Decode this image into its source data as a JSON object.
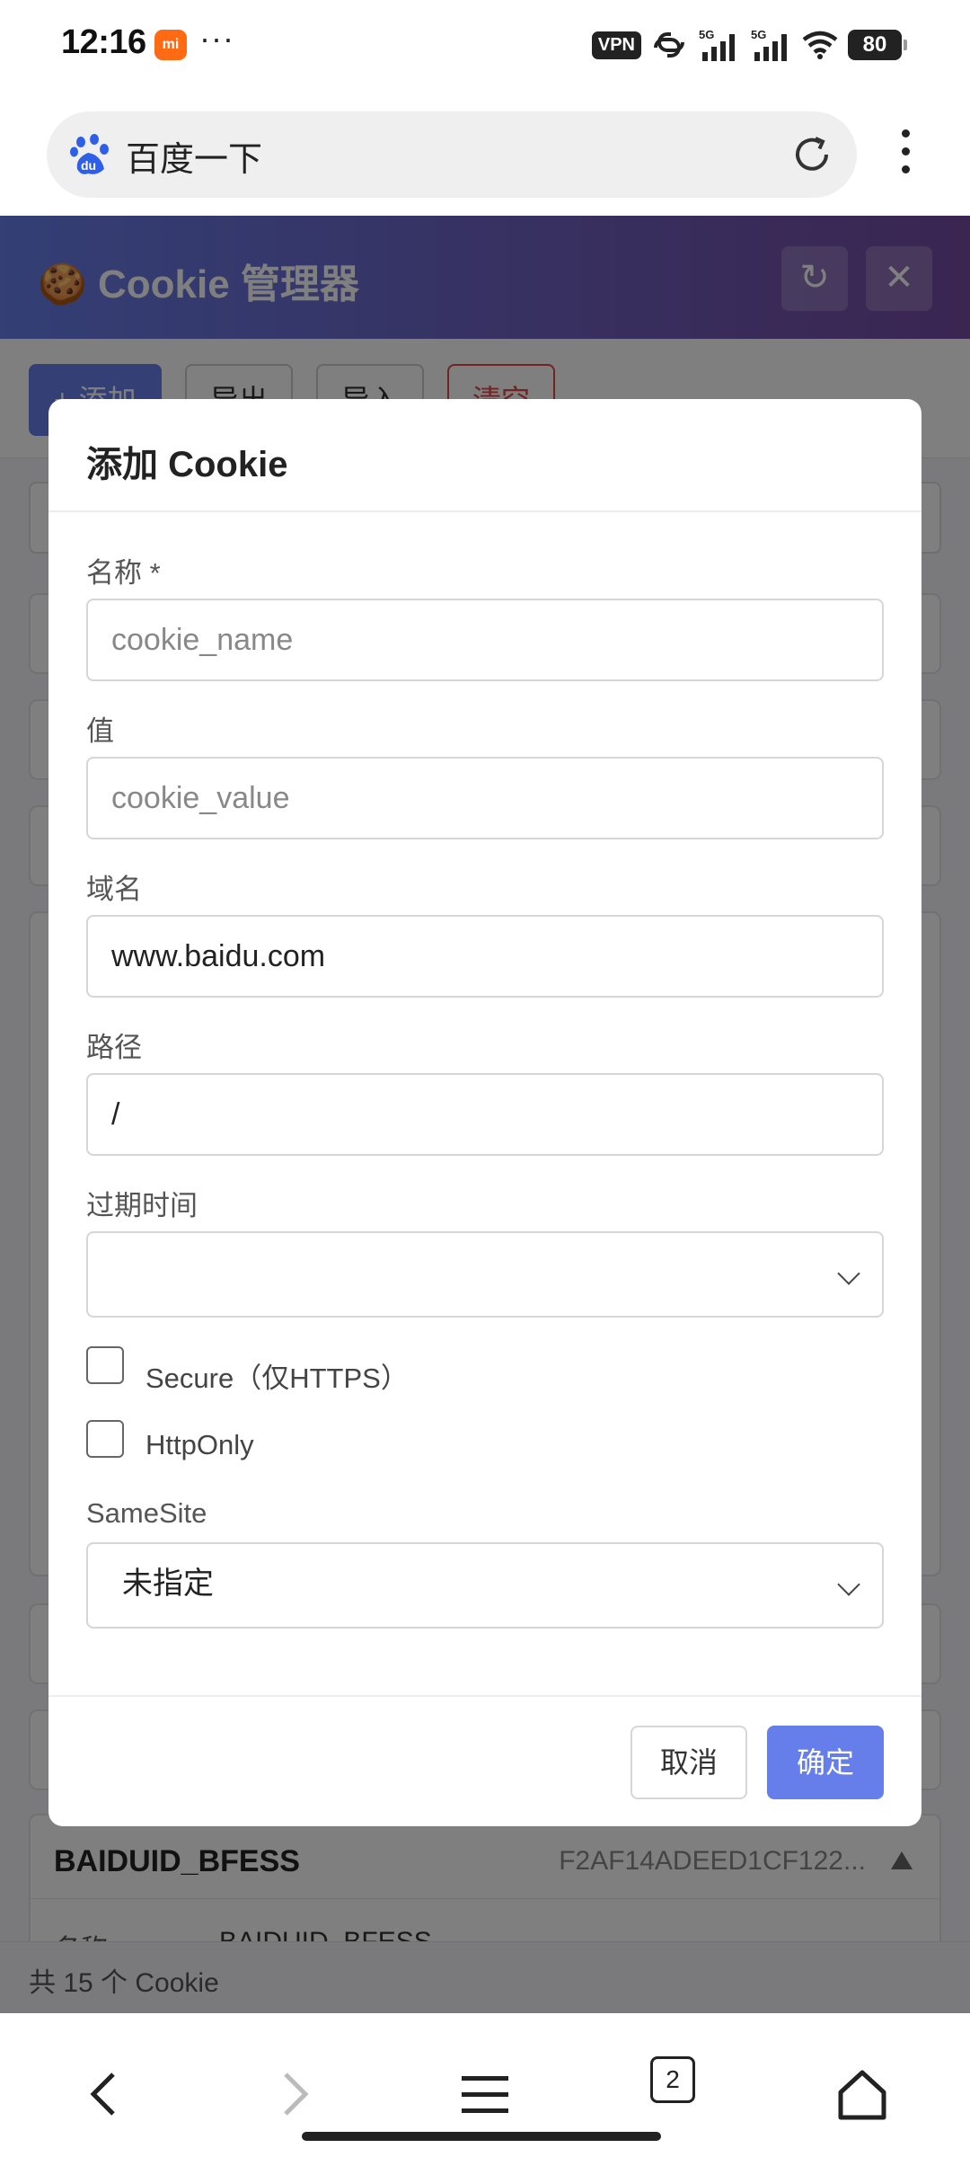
{
  "status_bar": {
    "time": "12:16",
    "mi_badge": "mi",
    "dots": "···",
    "vpn": "VPN",
    "signal1": "5G",
    "signal2": "5G",
    "battery": "80"
  },
  "browser": {
    "url_text": "百度一下",
    "tab_count": "2"
  },
  "app": {
    "title": "🍪 Cookie 管理器",
    "refresh_label": "↻",
    "close_label": "✕",
    "toolbar": {
      "add": "+ 添加",
      "export": "导出",
      "import": "导入",
      "clear": "清空"
    },
    "visible_cookie": {
      "name": "BAIDUID_BFESS",
      "value_preview": "F2AF14ADEED1CF122...",
      "detail_label": "名称:",
      "detail_value": "BAIDUID_BFESS"
    },
    "footer_count": "共 15 个 Cookie"
  },
  "modal": {
    "title": "添加 Cookie",
    "fields": {
      "name_label": "名称 *",
      "name_placeholder": "cookie_name",
      "value_label": "值",
      "value_placeholder": "cookie_value",
      "domain_label": "域名",
      "domain_value": "www.baidu.com",
      "path_label": "路径",
      "path_value": "/",
      "expiry_label": "过期时间",
      "expiry_value": "",
      "secure_label": "Secure（仅HTTPS）",
      "httponly_label": "HttpOnly",
      "samesite_label": "SameSite",
      "samesite_value": "未指定"
    },
    "cancel": "取消",
    "confirm": "确定"
  },
  "colors": {
    "accent": "#667eea",
    "header_gradient_end": "#764ba2",
    "danger": "#e04848"
  }
}
